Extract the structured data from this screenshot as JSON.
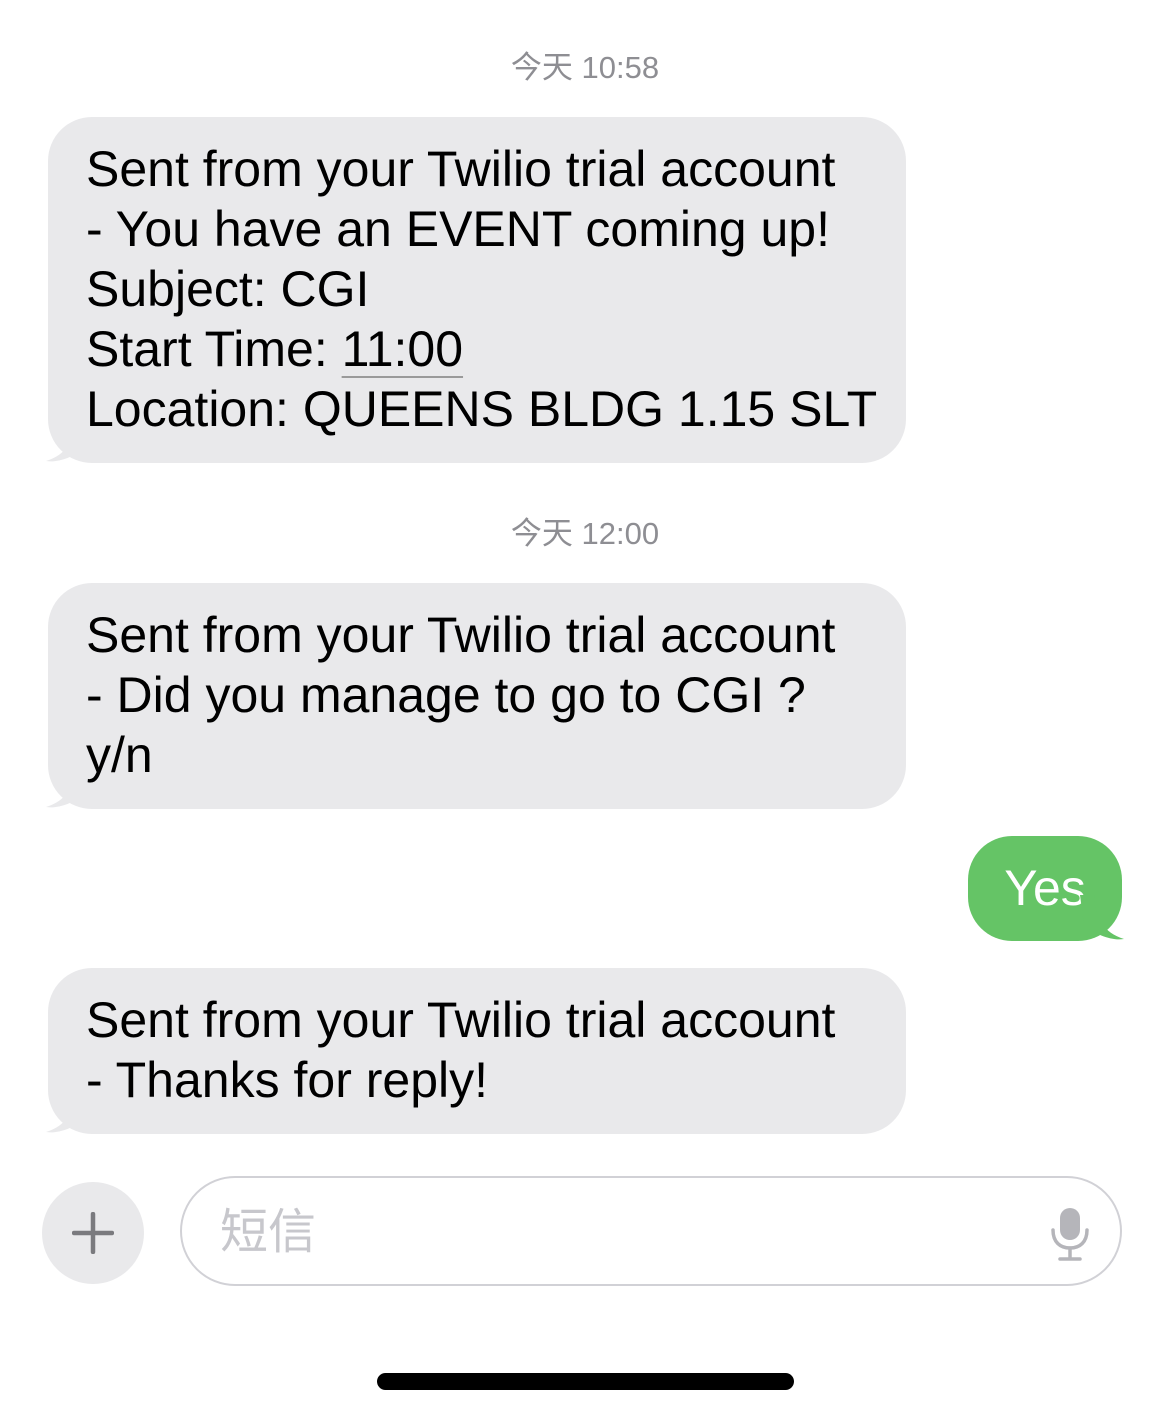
{
  "conversation": {
    "timestamps": [
      "今天 10:58",
      "今天 12:00"
    ],
    "messages": [
      {
        "direction": "incoming",
        "lines": [
          "Sent from your Twilio trial account",
          "- You have an EVENT coming up!",
          "Subject: CGI",
          "Start Time: ",
          "Location: QUEENS BLDG 1.15 SLT"
        ],
        "time_link": "11:00"
      },
      {
        "direction": "incoming",
        "lines": [
          "Sent from your Twilio trial account",
          "- Did you manage to go to CGI ?",
          "y/n"
        ]
      },
      {
        "direction": "outgoing",
        "text": "Yes"
      },
      {
        "direction": "incoming",
        "lines": [
          "Sent from your Twilio trial account",
          "- Thanks for reply!"
        ]
      }
    ]
  },
  "composer": {
    "add_icon": "plus-icon",
    "placeholder": "短信",
    "mic_icon": "microphone-icon"
  },
  "colors": {
    "incoming_bubble": "#e9e9eb",
    "outgoing_bubble": "#65c466",
    "timestamp_text": "#8e8e93",
    "placeholder_text": "#c7c7cc"
  }
}
